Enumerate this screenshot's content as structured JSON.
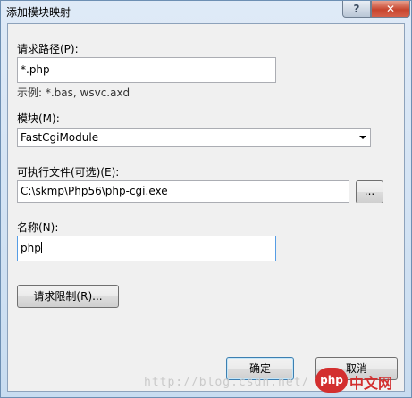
{
  "window": {
    "title": "添加模块映射",
    "help_label": "?",
    "close_label": "✕"
  },
  "request_path": {
    "label": "请求路径(P):",
    "value": "*.php",
    "example": "示例: *.bas, wsvc.axd"
  },
  "module": {
    "label": "模块(M):",
    "selected": "FastCgiModule"
  },
  "executable": {
    "label": "可执行文件(可选)(E):",
    "value": "C:\\skmp\\Php56\\php-cgi.exe",
    "browse_label": "..."
  },
  "name": {
    "label": "名称(N):",
    "value": "php"
  },
  "request_restrictions": {
    "label": "请求限制(R)..."
  },
  "footer": {
    "ok_label": "确定",
    "cancel_label": "取消"
  },
  "watermark": {
    "text": "http://blog.csdn.net/",
    "logo_text": "php",
    "logo_suffix": "中文网"
  }
}
